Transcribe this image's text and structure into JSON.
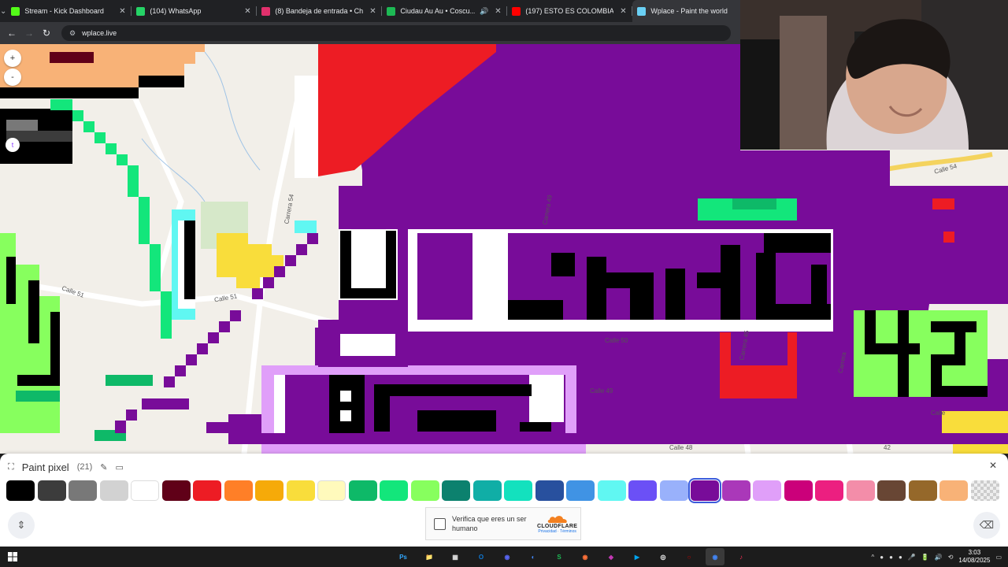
{
  "browser": {
    "tabs": [
      {
        "title": "Stream - Kick Dashboard",
        "favicon_color": "#53fc18",
        "active": false
      },
      {
        "title": "(104) WhatsApp",
        "favicon_color": "#25d366",
        "active": false
      },
      {
        "title": "(8) Bandeja de entrada • Chats",
        "favicon_color": "#e1306c",
        "active": false
      },
      {
        "title": "Ciudau Au Au • Coscu...",
        "favicon_color": "#1db954",
        "active": false,
        "audio": true
      },
      {
        "title": "(197) ESTO ES COLOMBIA #3 |...",
        "favicon_color": "#ff0000",
        "active": false
      },
      {
        "title": "Wplace - Paint the world",
        "favicon_color": "#6ad0f5",
        "active": true
      }
    ],
    "url": "wplace.live",
    "nav": {
      "back": "←",
      "forward": "→",
      "reload": "↻",
      "site_info": "⚙",
      "tab_menu": "⌄",
      "tab_close": "✕",
      "audio": "🔊"
    }
  },
  "map": {
    "zoom_in": "+",
    "zoom_out": "-",
    "twitch": "t",
    "street_labels": [
      "Calle 51",
      "Calle 51",
      "Carrera 54",
      "Calle 50",
      "Calle 49",
      "Calle 48",
      "Carrera 45",
      "Carrera 49",
      "Calle 54",
      "Calle",
      "Carrera",
      "42"
    ]
  },
  "panel": {
    "title": "Paint pixel",
    "count": "(21)",
    "icons": {
      "fullscreen": "⛶",
      "pencil": "✎",
      "bucket": "▭",
      "close": "✕",
      "expand": "⇕",
      "eraser": "⌫"
    },
    "palette": [
      {
        "color": "#000000",
        "name": "black"
      },
      {
        "color": "#3c3c3c",
        "name": "dark-gray"
      },
      {
        "color": "#787878",
        "name": "gray"
      },
      {
        "color": "#d2d2d2",
        "name": "light-gray"
      },
      {
        "color": "#ffffff",
        "name": "white"
      },
      {
        "color": "#600018",
        "name": "deep-red"
      },
      {
        "color": "#ed1c24",
        "name": "red"
      },
      {
        "color": "#ff7f27",
        "name": "orange"
      },
      {
        "color": "#f6aa09",
        "name": "gold"
      },
      {
        "color": "#f9dd3b",
        "name": "yellow"
      },
      {
        "color": "#fffabc",
        "name": "light-yellow"
      },
      {
        "color": "#0eb968",
        "name": "dark-green"
      },
      {
        "color": "#13e67b",
        "name": "green"
      },
      {
        "color": "#87ff5e",
        "name": "light-green"
      },
      {
        "color": "#0c816e",
        "name": "dark-teal"
      },
      {
        "color": "#10aea6",
        "name": "teal"
      },
      {
        "color": "#13e1be",
        "name": "light-teal"
      },
      {
        "color": "#28509e",
        "name": "dark-blue"
      },
      {
        "color": "#4093e4",
        "name": "blue"
      },
      {
        "color": "#60f7f2",
        "name": "cyan"
      },
      {
        "color": "#6b50f6",
        "name": "indigo"
      },
      {
        "color": "#99b1fb",
        "name": "light-indigo"
      },
      {
        "color": "#780c99",
        "name": "dark-purple"
      },
      {
        "color": "#aa38b9",
        "name": "purple"
      },
      {
        "color": "#e09ff9",
        "name": "light-purple"
      },
      {
        "color": "#cb007a",
        "name": "dark-pink"
      },
      {
        "color": "#ec1f80",
        "name": "pink"
      },
      {
        "color": "#f38da9",
        "name": "light-pink"
      },
      {
        "color": "#684634",
        "name": "dark-brown"
      },
      {
        "color": "#95682a",
        "name": "brown"
      },
      {
        "color": "#f8b277",
        "name": "beige"
      },
      {
        "color": "transparent",
        "name": "transparent"
      }
    ],
    "selected_index": 22,
    "captcha": {
      "text": "Verifica que eres un ser humano",
      "brand": "CLOUDFLARE",
      "links": "Privacidad · Términos"
    }
  },
  "taskbar": {
    "apps": [
      "Ps",
      "📁",
      "▦",
      "O",
      "◉",
      "◐",
      "S",
      "◉",
      "◆",
      "▶",
      "◎",
      "○",
      "◉",
      "♪"
    ],
    "app_colors": [
      "#31a8ff",
      "#f5c542",
      "#e0e0e0",
      "#0f78d4",
      "#5865f2",
      "#4285f4",
      "#1db954",
      "#ff7139",
      "#c239b3",
      "#00a4ef",
      "#ffffff",
      "#cc0000",
      "#4285f4",
      "#fe2c55"
    ],
    "active_index": 12,
    "time": "3:03",
    "date": "14/08/2025",
    "tray_icons": [
      "^",
      "●",
      "●",
      "●",
      "🎤",
      "🔋",
      "🔊",
      "⟲"
    ],
    "notification": "▭"
  }
}
